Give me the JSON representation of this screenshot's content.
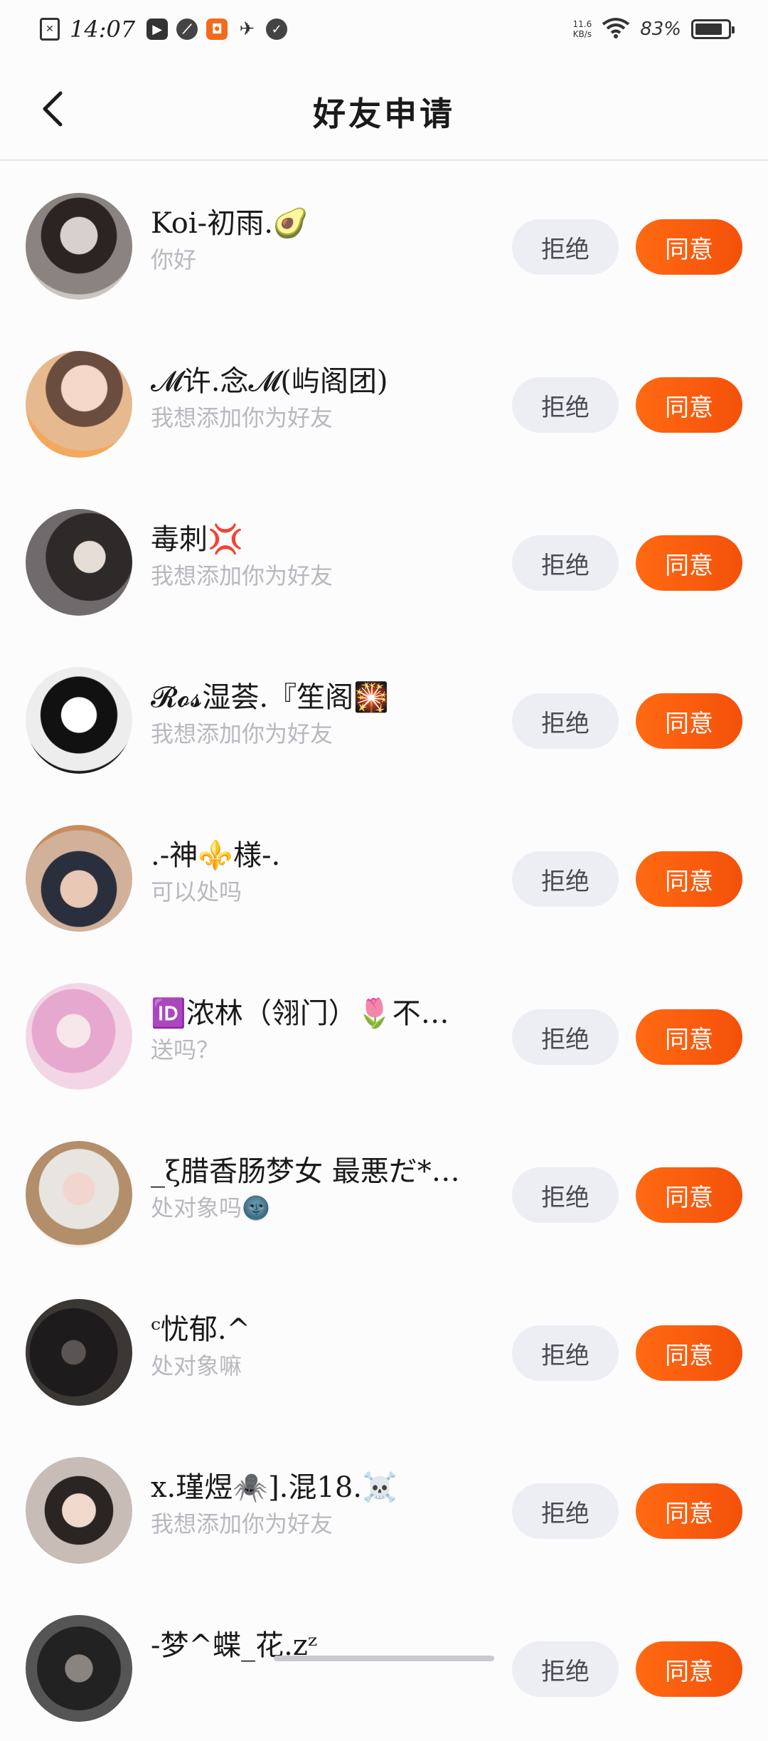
{
  "status_bar": {
    "time": "14:07",
    "net_speed_value": "11.6",
    "net_speed_unit": "KB/s",
    "battery": "83%",
    "battery_level": 0.83,
    "icons": [
      "notification-x-icon",
      "video-app-icon",
      "link-app-icon",
      "shop-app-icon",
      "airplane-icon",
      "check-circle-icon",
      "wifi-icon",
      "battery-icon"
    ]
  },
  "header": {
    "title": "好友申请",
    "back_icon": "chevron-left-icon"
  },
  "buttons": {
    "reject_label": "拒绝",
    "accept_label": "同意"
  },
  "colors": {
    "accent": "#f85a0d",
    "reject_bg": "#eceef4",
    "hint_text": "#b8b8bf"
  },
  "requests": [
    {
      "nickname": "Koi-初雨.🥑",
      "message": "你好"
    },
    {
      "nickname": "𝓜许.念𝓜(屿阁团)",
      "message": "我想添加你为好友"
    },
    {
      "nickname": "毒刺💢",
      "message": "我想添加你为好友"
    },
    {
      "nickname": "𝓡𝓸𝓼湿荟.『笙阁🎇",
      "message": "我想添加你为好友"
    },
    {
      "nickname": ".-神⚜️様-.",
      "message": "可以处吗"
    },
    {
      "nickname": "🆔浓林（翎门）🌷不…",
      "message": "送吗？"
    },
    {
      "nickname": "_ξ腊香肠梦女 最悪だ*…",
      "message": "处对象吗🌚"
    },
    {
      "nickname": "ᶜ忧郁.^",
      "message": "处对象嘛"
    },
    {
      "nickname": "x.瑾煜🕷️].混18.☠️",
      "message": "我想添加你为好友"
    },
    {
      "nickname": "-梦^蝶_花.zᶻ",
      "message": ""
    }
  ]
}
